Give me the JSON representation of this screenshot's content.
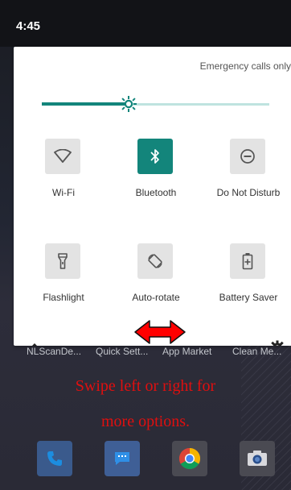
{
  "status_bar": {
    "time": "4:45"
  },
  "quick_settings": {
    "emergency_text": "Emergency calls only",
    "brightness_level": 0.38,
    "tiles": [
      {
        "label": "Wi-Fi",
        "icon": "wifi-icon",
        "active": false
      },
      {
        "label": "Bluetooth",
        "icon": "bluetooth-icon",
        "active": true
      },
      {
        "label": "Do Not Disturb",
        "icon": "do-not-disturb-icon",
        "active": false
      },
      {
        "label": "Flashlight",
        "icon": "flashlight-icon",
        "active": false
      },
      {
        "label": "Auto-rotate",
        "icon": "auto-rotate-icon",
        "active": false
      },
      {
        "label": "Battery Saver",
        "icon": "battery-saver-icon",
        "active": false
      }
    ],
    "page_indicator": {
      "pages": 2,
      "current": 1
    }
  },
  "annotation": {
    "line1": "Swipe left or right for",
    "line2": "more options."
  },
  "app_drawer": {
    "labels": [
      "NLScanDe...",
      "Quick Sett...",
      "App Market",
      "Clean Me..."
    ]
  },
  "dock": {
    "apps": [
      "phone-icon",
      "messages-icon",
      "chrome-icon",
      "camera-icon"
    ]
  },
  "colors": {
    "accent": "#13857b",
    "annotation_red": "#e00f0f"
  }
}
